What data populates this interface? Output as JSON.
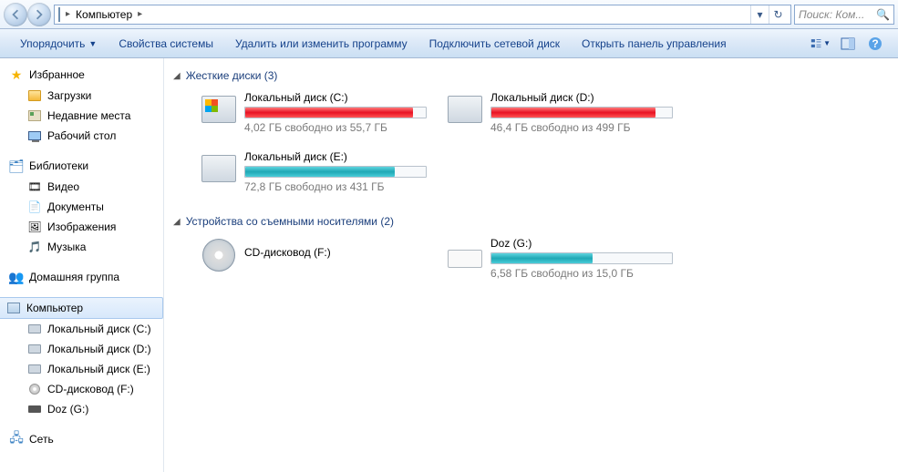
{
  "breadcrumb": {
    "root_icon": "computer-icon",
    "item1": "Компьютер"
  },
  "search": {
    "placeholder": "Поиск: Ком..."
  },
  "toolbar": {
    "organize": "Упорядочить",
    "props": "Свойства системы",
    "uninstall": "Удалить или изменить программу",
    "mapdrive": "Подключить сетевой диск",
    "ctrlpanel": "Открыть панель управления"
  },
  "nav": {
    "favorites": {
      "label": "Избранное",
      "downloads": "Загрузки",
      "recent": "Недавние места",
      "desktop": "Рабочий стол"
    },
    "libraries": {
      "label": "Библиотеки",
      "video": "Видео",
      "docs": "Документы",
      "pics": "Изображения",
      "music": "Музыка"
    },
    "homegroup": {
      "label": "Домашняя группа"
    },
    "computer": {
      "label": "Компьютер",
      "c": "Локальный диск (C:)",
      "d": "Локальный диск (D:)",
      "e": "Локальный диск (E:)",
      "f": "CD-дисковод (F:)",
      "g": "Doz (G:)"
    },
    "network": {
      "label": "Сеть"
    }
  },
  "groups": {
    "hdd": {
      "label": "Жесткие диски (3)"
    },
    "removable": {
      "label": "Устройства со съемными носителями (2)"
    }
  },
  "drives": {
    "c": {
      "name": "Локальный диск (C:)",
      "sub": "4,02 ГБ свободно из 55,7 ГБ",
      "pct": 93,
      "color": "red"
    },
    "d": {
      "name": "Локальный диск (D:)",
      "sub": "46,4 ГБ свободно из 499 ГБ",
      "pct": 91,
      "color": "red"
    },
    "e": {
      "name": "Локальный диск (E:)",
      "sub": "72,8 ГБ свободно из 431 ГБ",
      "pct": 83,
      "color": "teal"
    },
    "f": {
      "name": "CD-дисковод (F:)"
    },
    "g": {
      "name": "Doz (G:)",
      "sub": "6,58 ГБ свободно из 15,0 ГБ",
      "pct": 56,
      "color": "teal"
    }
  }
}
